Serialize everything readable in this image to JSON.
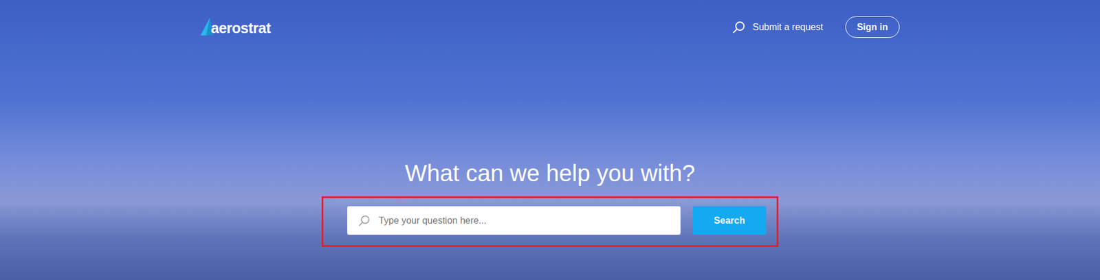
{
  "header": {
    "logo": "aerostrat",
    "nav": {
      "submit_request": "Submit a request",
      "sign_in": "Sign in"
    }
  },
  "hero": {
    "heading": "What can we help you with?"
  },
  "search": {
    "placeholder": "Type your question here...",
    "button": "Search",
    "highlighted": true
  }
}
